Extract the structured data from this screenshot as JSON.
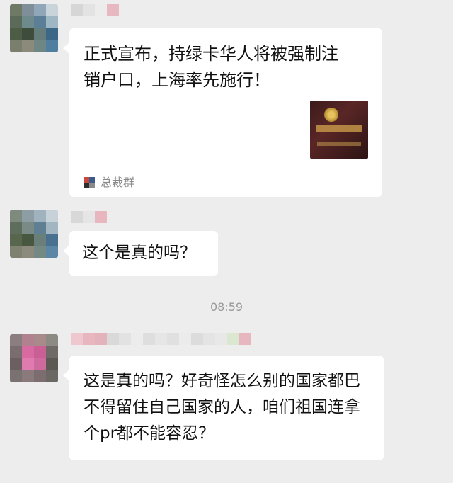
{
  "messages": [
    {
      "type": "card",
      "text": "正式宣布，持绿卡华人将被强制注销户口，上海率先施行！",
      "source": "总裁群",
      "thumb_icon": "household-register-photo"
    },
    {
      "type": "text",
      "text": "这个是真的吗？"
    },
    {
      "type": "text",
      "text": "这是真的吗？好奇怪怎么别的国家都巴不得留住自己国家的人，咱们祖国连拿个pr都不能容忍？"
    }
  ],
  "timestamp": "08:59",
  "colors": {
    "background": "#ededed",
    "bubble": "#ffffff",
    "timestamp": "#9a9a9a",
    "source_text": "#8a8a8a"
  }
}
